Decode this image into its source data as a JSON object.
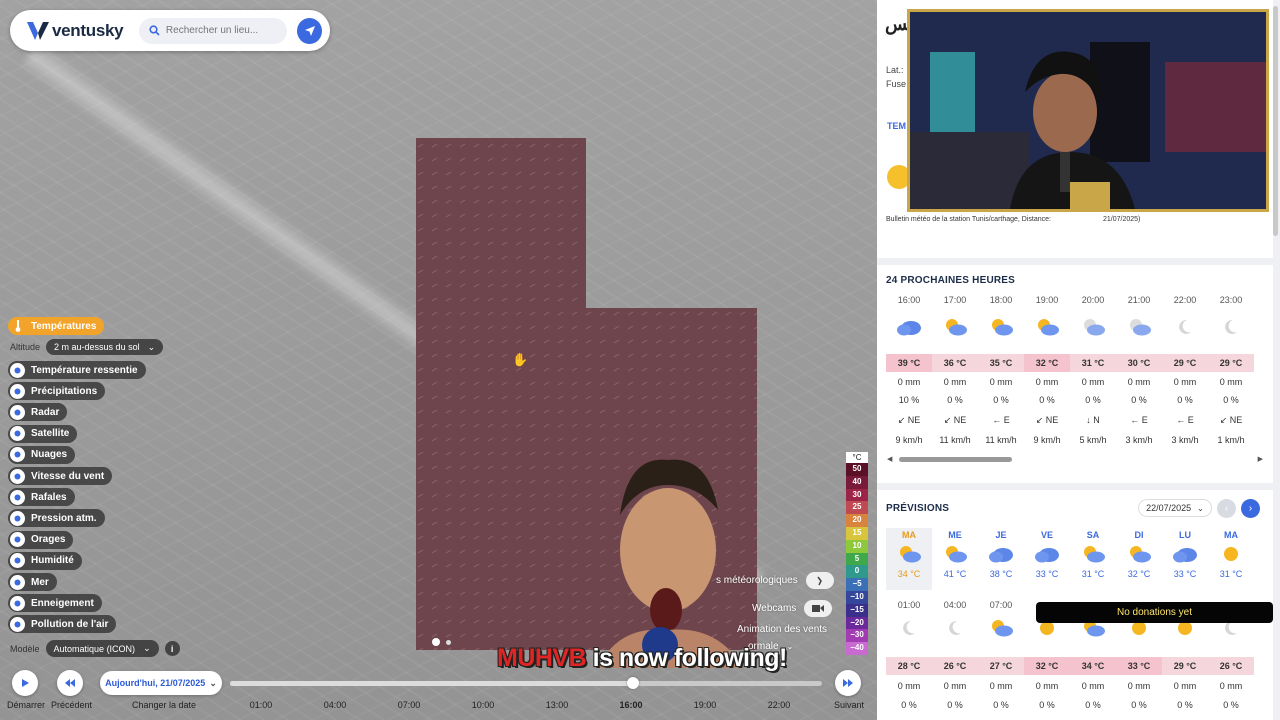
{
  "app": {
    "name": "ventusky"
  },
  "search": {
    "placeholder": "Rechercher un lieu..."
  },
  "layers": {
    "active": "Températures",
    "altitude_label": "Altitude",
    "altitude_value": "2 m au-dessus du sol",
    "items": [
      {
        "label": "Température ressentie",
        "icon": "thermometer-feel-icon"
      },
      {
        "label": "Précipitations",
        "icon": "drop-icon"
      },
      {
        "label": "Radar",
        "icon": "radar-icon"
      },
      {
        "label": "Satellite",
        "icon": "satellite-icon"
      },
      {
        "label": "Nuages",
        "icon": "cloud-icon"
      },
      {
        "label": "Vitesse du vent",
        "icon": "wind-icon"
      },
      {
        "label": "Rafales",
        "icon": "gust-icon"
      },
      {
        "label": "Pression atm.",
        "icon": "pressure-icon"
      },
      {
        "label": "Orages",
        "icon": "storm-icon"
      },
      {
        "label": "Humidité",
        "icon": "humidity-icon"
      },
      {
        "label": "Mer",
        "icon": "waves-icon"
      },
      {
        "label": "Enneigement",
        "icon": "snowflake-icon"
      },
      {
        "label": "Pollution de l'air",
        "icon": "pollution-icon"
      }
    ],
    "model_label": "Modèle",
    "model_value": "Automatique (ICON)"
  },
  "legend": {
    "unit": "°C",
    "values": [
      "50",
      "40",
      "30",
      "25",
      "20",
      "15",
      "10",
      "5",
      "0",
      "−5",
      "−10",
      "−15",
      "−20",
      "−30",
      "−40"
    ],
    "colors": [
      "#5a1027",
      "#7a1a3a",
      "#9b2447",
      "#c04a52",
      "#d9843e",
      "#d8c53c",
      "#8ec83b",
      "#3ea84a",
      "#2f9a8c",
      "#3b6fb8",
      "#34479b",
      "#3b2f8c",
      "#6b2a9b",
      "#a33bb3",
      "#c86ad0"
    ]
  },
  "map_overlay": {
    "stations_label": "s météorologiques",
    "webcams_label": "Webcams",
    "wind_anim_label": "Animation des vents",
    "wind_anim_value": "ormale"
  },
  "timeline": {
    "play_label": "Démarrer",
    "prev_label": "Précédent",
    "date_value": "Aujourd'hui, 21/07/2025",
    "change_date_label": "Changer la date",
    "next_label": "Suivant",
    "hours": [
      "01:00",
      "04:00",
      "07:00",
      "10:00",
      "13:00",
      "16:00",
      "19:00",
      "22:00"
    ],
    "current_hour": "16:00",
    "progress": 0.68
  },
  "station": {
    "title_partial": "نس",
    "lat_label": "Lat.:",
    "tz_label": "Fuse",
    "tab_partial": "TEM",
    "bulletin_left": "Bulletin météo de la station Tunis/carthage, Distance:",
    "bulletin_right": "21/07/2025)"
  },
  "next24": {
    "title": "24 PROCHAINES HEURES",
    "hours": [
      {
        "time": "16:00",
        "icon": "cloud-icon",
        "temp": "39 °C",
        "precip": "0 mm",
        "prob": "10 %",
        "wind_dir": "↙ NE",
        "wind": "9 km/h"
      },
      {
        "time": "17:00",
        "icon": "sun-cloud-icon",
        "temp": "36 °C",
        "precip": "0 mm",
        "prob": "0 %",
        "wind_dir": "↙ NE",
        "wind": "11 km/h"
      },
      {
        "time": "18:00",
        "icon": "sun-cloud-icon",
        "temp": "35 °C",
        "precip": "0 mm",
        "prob": "0 %",
        "wind_dir": "← E",
        "wind": "11 km/h"
      },
      {
        "time": "19:00",
        "icon": "sun-cloud-icon",
        "temp": "32 °C",
        "precip": "0 mm",
        "prob": "0 %",
        "wind_dir": "↙ NE",
        "wind": "9 km/h"
      },
      {
        "time": "20:00",
        "icon": "moon-cloud-icon",
        "temp": "31 °C",
        "precip": "0 mm",
        "prob": "0 %",
        "wind_dir": "↓ N",
        "wind": "5 km/h"
      },
      {
        "time": "21:00",
        "icon": "moon-cloud-icon",
        "temp": "30 °C",
        "precip": "0 mm",
        "prob": "0 %",
        "wind_dir": "← E",
        "wind": "3 km/h"
      },
      {
        "time": "22:00",
        "icon": "moon-icon",
        "temp": "29 °C",
        "precip": "0 mm",
        "prob": "0 %",
        "wind_dir": "← E",
        "wind": "3 km/h"
      },
      {
        "time": "23:00",
        "icon": "moon-icon",
        "temp": "29 °C",
        "precip": "0 mm",
        "prob": "0 %",
        "wind_dir": "↙ NE",
        "wind": "1 km/h"
      }
    ]
  },
  "forecast": {
    "title": "PRÉVISIONS",
    "date_value": "22/07/2025",
    "days": [
      {
        "day": "MA",
        "icon": "sun-cloud-icon",
        "temp": "34 °C"
      },
      {
        "day": "ME",
        "icon": "sun-cloud-icon",
        "temp": "41 °C"
      },
      {
        "day": "JE",
        "icon": "cloud-icon",
        "temp": "38 °C"
      },
      {
        "day": "VE",
        "icon": "cloud-icon",
        "temp": "33 °C"
      },
      {
        "day": "SA",
        "icon": "sun-cloud-icon",
        "temp": "31 °C"
      },
      {
        "day": "DI",
        "icon": "sun-cloud-icon",
        "temp": "32 °C"
      },
      {
        "day": "LU",
        "icon": "cloud-icon",
        "temp": "33 °C"
      },
      {
        "day": "MA",
        "icon": "sun-icon",
        "temp": "31 °C"
      }
    ],
    "hours": [
      {
        "time": "01:00",
        "icon": "moon-icon",
        "temp": "28 °C",
        "precip": "0 mm",
        "prob": "0 %"
      },
      {
        "time": "04:00",
        "icon": "moon-icon",
        "temp": "26 °C",
        "precip": "0 mm",
        "prob": "0 %"
      },
      {
        "time": "07:00",
        "icon": "sun-cloud-icon",
        "temp": "27 °C",
        "precip": "0 mm",
        "prob": "0 %"
      },
      {
        "time": "",
        "icon": "sun-icon",
        "temp": "32 °C",
        "precip": "0 mm",
        "prob": "0 %"
      },
      {
        "time": "",
        "icon": "sun-cloud-icon",
        "temp": "34 °C",
        "precip": "0 mm",
        "prob": "0 %"
      },
      {
        "time": "",
        "icon": "sun-icon",
        "temp": "33 °C",
        "precip": "0 mm",
        "prob": "0 %"
      },
      {
        "time": "",
        "icon": "sun-icon",
        "temp": "29 °C",
        "precip": "0 mm",
        "prob": "0 %"
      },
      {
        "time": "",
        "icon": "moon-icon",
        "temp": "26 °C",
        "precip": "0 mm",
        "prob": "0 %"
      }
    ]
  },
  "overlays": {
    "donations": "No donations yet",
    "follow_user": "MUHVB",
    "follow_text": " is now following!"
  }
}
